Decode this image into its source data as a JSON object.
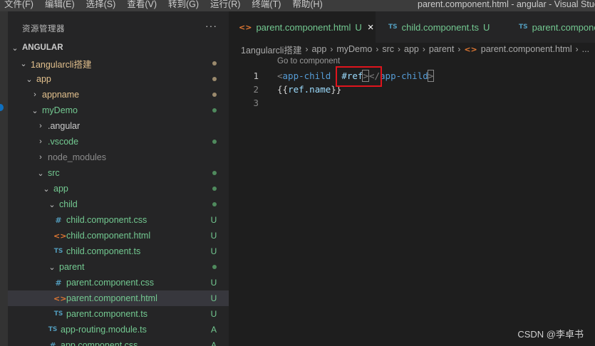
{
  "menu": [
    "文件(F)",
    "编辑(E)",
    "选择(S)",
    "查看(V)",
    "转到(G)",
    "运行(R)",
    "终端(T)",
    "帮助(H)"
  ],
  "window_title": "parent.component.html - angular - Visual Studio Code",
  "sidebar": {
    "title": "资源管理器",
    "more": "···",
    "root": "ANGULAR",
    "items": [
      {
        "label": "1angularcli搭建",
        "status": "mod"
      },
      {
        "label": "app",
        "status": "mod"
      },
      {
        "label": "appname",
        "status": "mod"
      },
      {
        "label": "myDemo",
        "status": "unt"
      },
      {
        "label": ".angular"
      },
      {
        "label": ".vscode",
        "status": "unt"
      },
      {
        "label": "node_modules"
      },
      {
        "label": "src",
        "status": "unt"
      },
      {
        "label": "app",
        "status": "unt"
      },
      {
        "label": "child",
        "status": "unt"
      },
      {
        "label": "child.component.css",
        "badge": "U"
      },
      {
        "label": "child.component.html",
        "badge": "U"
      },
      {
        "label": "child.component.ts",
        "badge": "U"
      },
      {
        "label": "parent",
        "status": "unt"
      },
      {
        "label": "parent.component.css",
        "badge": "U"
      },
      {
        "label": "parent.component.html",
        "badge": "U"
      },
      {
        "label": "parent.component.ts",
        "badge": "U"
      },
      {
        "label": "app-routing.module.ts",
        "badge": "A"
      },
      {
        "label": "app.component.css",
        "badge": "A"
      }
    ]
  },
  "tabs": [
    {
      "label": "parent.component.html",
      "status": "U",
      "close": "×"
    },
    {
      "label": "child.component.ts",
      "status": "U"
    },
    {
      "label": "parent.component.ts"
    }
  ],
  "breadcrumb": [
    "1angularcli搭建",
    "app",
    "myDemo",
    "src",
    "app",
    "parent",
    "parent.component.html",
    "..."
  ],
  "editor": {
    "codelens": "Go to component",
    "line_numbers": [
      "1",
      "2",
      "3"
    ],
    "line1": {
      "open_lt": "<",
      "tag": "app-child",
      "attr": "#ref",
      "gt": ">",
      "close_lt": "</",
      "close_tag": "app-child",
      "close_gt": ">"
    },
    "line2": {
      "open": "{{",
      "expr": "ref.name",
      "close": "}}"
    }
  },
  "watermark": "CSDN @李卓书",
  "colors": {
    "modified": "#e2c08d",
    "untracked": "#73c991",
    "highlight_box": "#e0141d"
  }
}
